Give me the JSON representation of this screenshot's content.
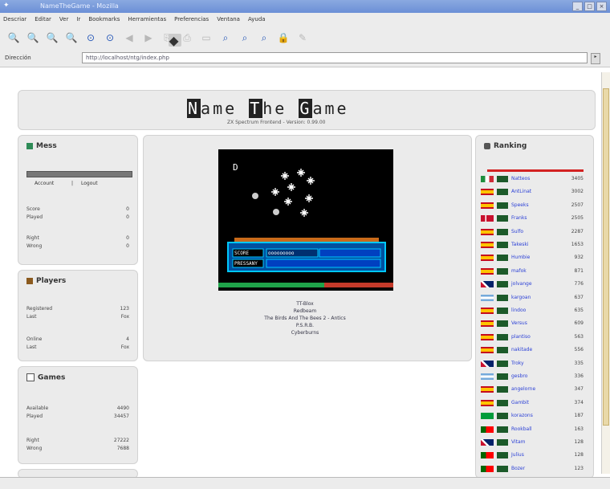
{
  "window": {
    "title": "NameTheGame - Mozilla"
  },
  "menu": [
    "Descriar",
    "Editar",
    "Ver",
    "Ir",
    "Bookmarks",
    "Herramientas",
    "Preferencias",
    "Ventana",
    "Ayuda"
  ],
  "location": {
    "label": "Dirección",
    "url": "http://localhost/ntg/index.php"
  },
  "site": {
    "brand": "NameTheGame",
    "logo_parts": [
      "N",
      "ame",
      "T",
      "he",
      "G",
      "ame"
    ],
    "subtitle": "ZX Spectrum Frontend  -  Version: 0.99.00"
  },
  "user_panel": {
    "title": "Mess",
    "links": [
      "Account",
      "Logout"
    ],
    "stats": [
      {
        "label": "Score",
        "value": "0"
      },
      {
        "label": "Played",
        "value": "0"
      },
      {
        "label": "Right",
        "value": "0"
      },
      {
        "label": "Wrong",
        "value": "0"
      }
    ]
  },
  "players_panel": {
    "title": "Players",
    "stats": [
      {
        "label": "Registered",
        "value": "123"
      },
      {
        "label": "Last",
        "value": "Fox"
      },
      {
        "label": "Online",
        "value": "4"
      },
      {
        "label": "Last",
        "value": "Fox"
      }
    ]
  },
  "games_panel": {
    "title": "Games",
    "stats": [
      {
        "label": "Available",
        "value": "4490"
      },
      {
        "label": "Played",
        "value": "34457"
      },
      {
        "label": "Right",
        "value": "27222"
      },
      {
        "label": "Wrong",
        "value": "7688"
      }
    ]
  },
  "game": {
    "hud_left": "SCORE",
    "hud_right": "ooooooooo",
    "hud_bottom": "PRESSANY",
    "options": [
      "TT-Blox",
      "Redbeam",
      "The Birds And The Bees 2 - Antics",
      "P.S.R.B.",
      "Cyberburns"
    ]
  },
  "ranking": {
    "title": "Ranking",
    "rows": [
      {
        "name": "Natteos",
        "score": "3405",
        "flag": "it"
      },
      {
        "name": "AntLinat",
        "score": "3002",
        "flag": "es"
      },
      {
        "name": "Speeks",
        "score": "2507",
        "flag": "es"
      },
      {
        "name": "Franks",
        "score": "2505",
        "flag": "dk"
      },
      {
        "name": "Sulfo",
        "score": "2287",
        "flag": "es"
      },
      {
        "name": "Takeski",
        "score": "1653",
        "flag": "es"
      },
      {
        "name": "Humbie",
        "score": "932",
        "flag": "es"
      },
      {
        "name": "mafok",
        "score": "871",
        "flag": "es"
      },
      {
        "name": "jolvange",
        "score": "776",
        "flag": "uk"
      },
      {
        "name": "kargoan",
        "score": "637",
        "flag": "ar"
      },
      {
        "name": "lindoo",
        "score": "635",
        "flag": "es"
      },
      {
        "name": "Versus",
        "score": "609",
        "flag": "es"
      },
      {
        "name": "plantiso",
        "score": "563",
        "flag": "es"
      },
      {
        "name": "nakitade",
        "score": "556",
        "flag": "es"
      },
      {
        "name": "Troky",
        "score": "335",
        "flag": "uk"
      },
      {
        "name": "gesbro",
        "score": "336",
        "flag": "ar"
      },
      {
        "name": "angelorne",
        "score": "347",
        "flag": "es"
      },
      {
        "name": "Gambit",
        "score": "374",
        "flag": "es"
      },
      {
        "name": "korazons",
        "score": "187",
        "flag": "br"
      },
      {
        "name": "Rookball",
        "score": "163",
        "flag": "pt"
      },
      {
        "name": "Vitam",
        "score": "128",
        "flag": "uk"
      },
      {
        "name": "Julius",
        "score": "128",
        "flag": "pt"
      },
      {
        "name": "Bozer",
        "score": "123",
        "flag": "pt"
      }
    ]
  },
  "colors": {
    "panel": "#ebebeb",
    "link": "#2a3fd6",
    "hud": "#00c8ff",
    "stage": "#000000"
  }
}
